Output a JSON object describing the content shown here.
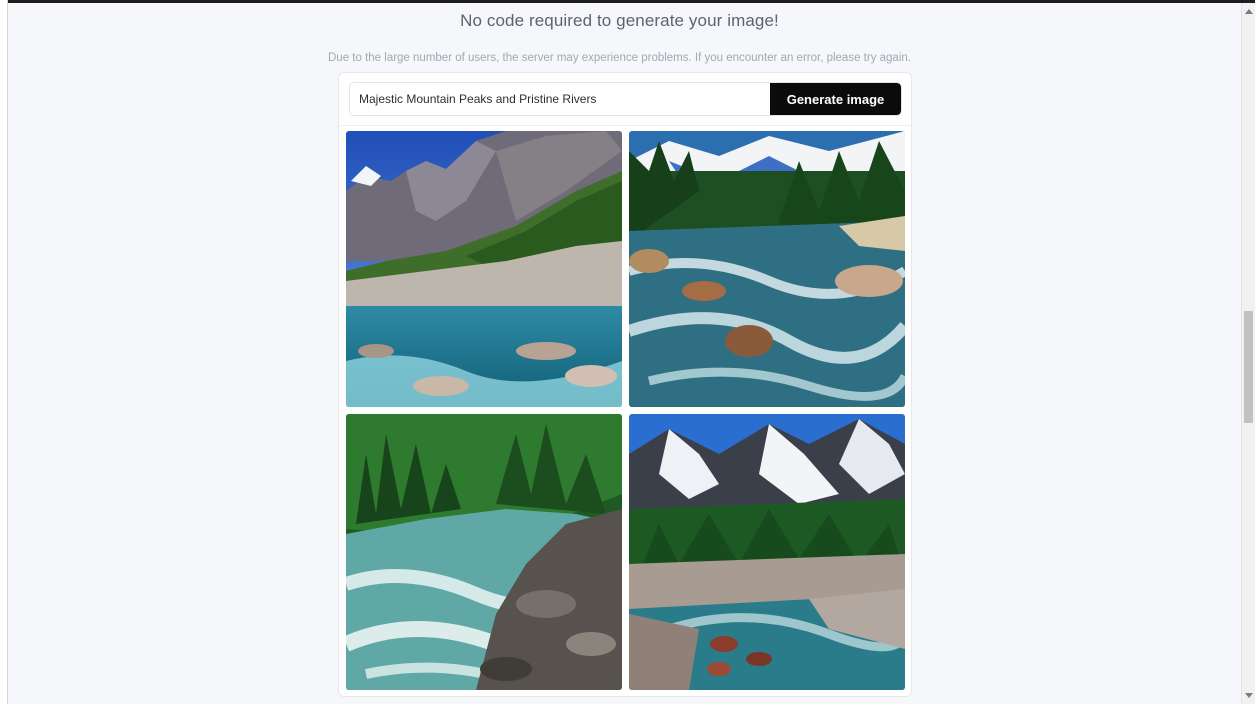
{
  "header": {
    "headline": "No code required to generate your image!",
    "notice": "Due to the large number of users, the server may experience problems. If you encounter an error, please try again."
  },
  "generator": {
    "prompt_value": "Majestic Mountain Peaks and Pristine Rivers",
    "generate_label": "Generate image"
  },
  "results": {
    "images": [
      {
        "subject": "mountain-lake-river-image"
      },
      {
        "subject": "rocky-forest-river-image"
      },
      {
        "subject": "forest-rapids-image"
      },
      {
        "subject": "snowy-peaks-river-image"
      }
    ]
  },
  "scroll": {
    "position_fraction": 0.44
  }
}
